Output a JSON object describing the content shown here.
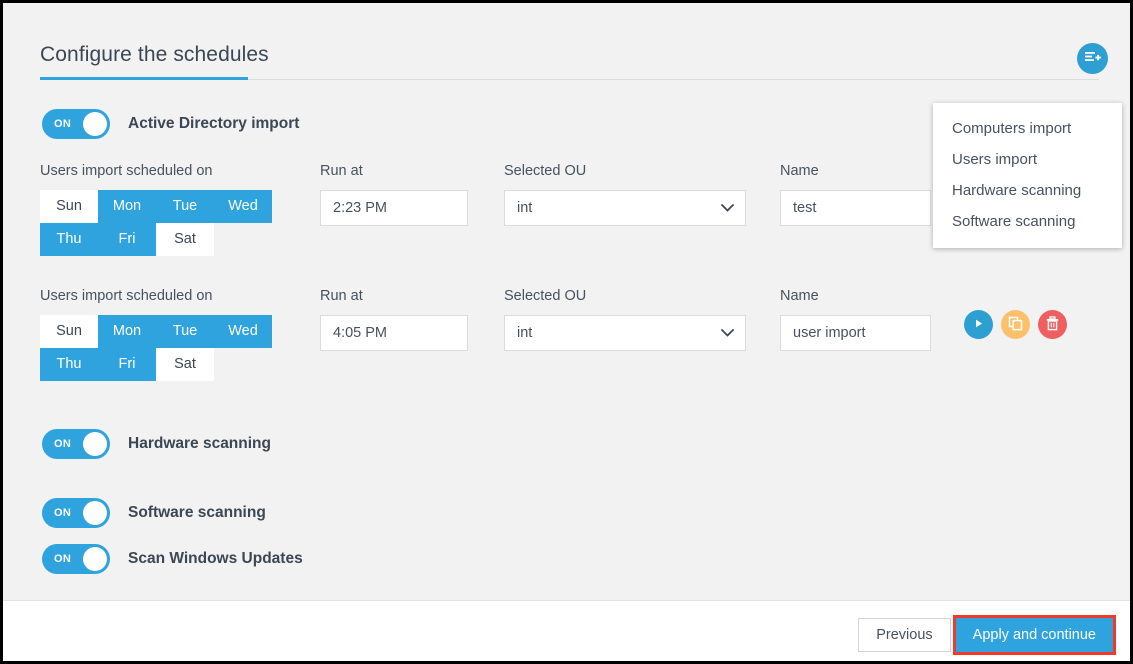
{
  "header": {
    "title": "Configure the schedules",
    "add_button_icon": "add-schedule-icon"
  },
  "menu": {
    "items": [
      {
        "label": "Computers import"
      },
      {
        "label": "Users import"
      },
      {
        "label": "Hardware scanning"
      },
      {
        "label": "Software scanning"
      }
    ]
  },
  "active_directory": {
    "toggle_state": "ON",
    "label": "Active Directory import"
  },
  "labels": {
    "days": "Users import scheduled on",
    "run_at": "Run at",
    "selected_ou": "Selected OU",
    "name": "Name"
  },
  "day_names": [
    "Sun",
    "Mon",
    "Tue",
    "Wed",
    "Thu",
    "Fri",
    "Sat"
  ],
  "schedules": [
    {
      "days_label": "Users import scheduled on",
      "days": [
        {
          "label": "Sun",
          "selected": false
        },
        {
          "label": "Mon",
          "selected": true
        },
        {
          "label": "Tue",
          "selected": true
        },
        {
          "label": "Wed",
          "selected": true
        },
        {
          "label": "Thu",
          "selected": true
        },
        {
          "label": "Fri",
          "selected": true
        },
        {
          "label": "Sat",
          "selected": false
        }
      ],
      "run_at": "2:23 PM",
      "run_at_placeholder": "Run at",
      "selected_ou": "int",
      "name": "test",
      "name_placeholder": "Name",
      "actions_visible": false
    },
    {
      "days_label": "Users import scheduled on",
      "days": [
        {
          "label": "Sun",
          "selected": false
        },
        {
          "label": "Mon",
          "selected": true
        },
        {
          "label": "Tue",
          "selected": true
        },
        {
          "label": "Wed",
          "selected": true
        },
        {
          "label": "Thu",
          "selected": true
        },
        {
          "label": "Fri",
          "selected": true
        },
        {
          "label": "Sat",
          "selected": false
        }
      ],
      "run_at": "4:05 PM",
      "run_at_placeholder": "Run at",
      "selected_ou": "int",
      "name": "user import",
      "name_placeholder": "Name",
      "actions_visible": true,
      "actions": [
        {
          "name": "run",
          "icon": "play-icon"
        },
        {
          "name": "duplicate",
          "icon": "copy-icon"
        },
        {
          "name": "delete",
          "icon": "trash-icon"
        }
      ]
    }
  ],
  "toggles": [
    {
      "state": "ON",
      "label": "Hardware scanning"
    },
    {
      "state": "ON",
      "label": "Software scanning"
    },
    {
      "state": "ON",
      "label": "Scan Windows Updates"
    }
  ],
  "footer": {
    "previous": "Previous",
    "apply": "Apply and continue"
  },
  "colors": {
    "accent_blue": "#2ea3dd",
    "button_blue": "#2e9fd2",
    "warning_orange": "#fdc06a",
    "danger_red": "#ef5f5f",
    "highlight_red": "#f0392b",
    "text": "#3b4754",
    "page_bg": "#f2f2f2"
  }
}
